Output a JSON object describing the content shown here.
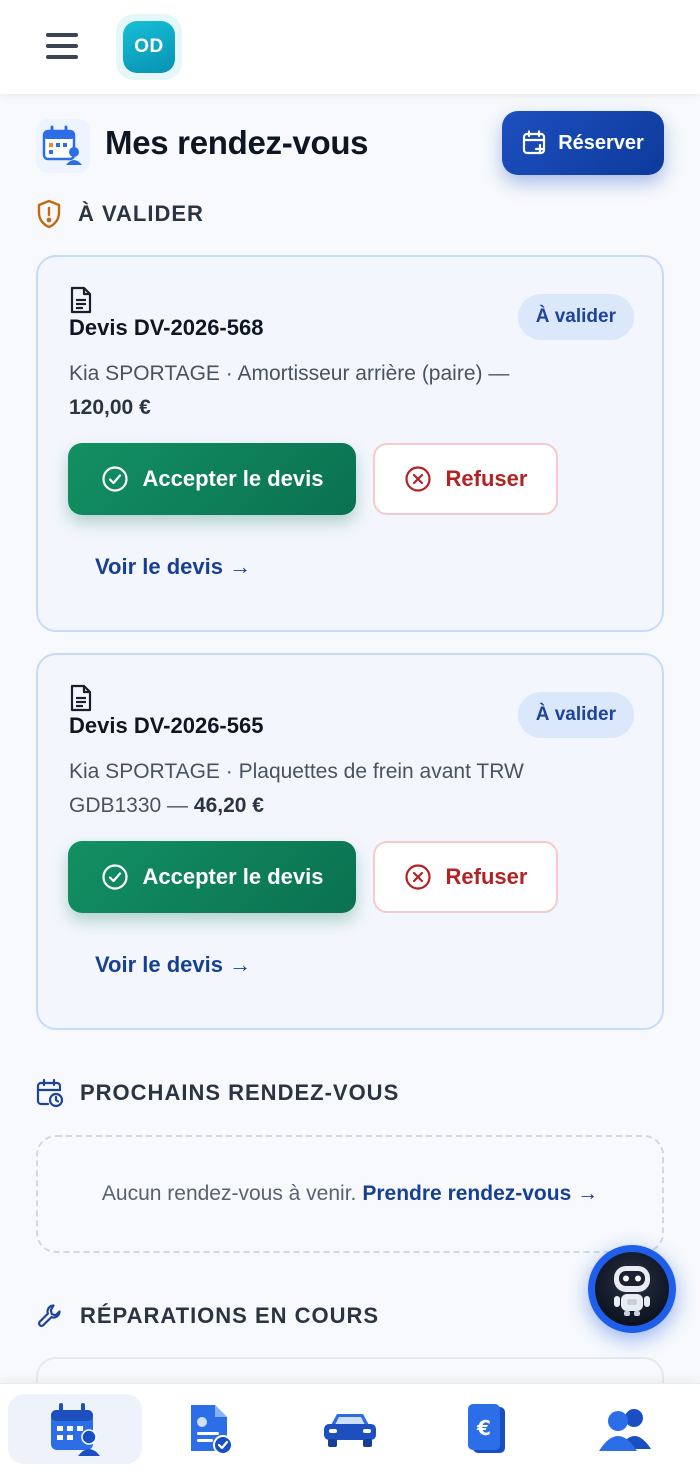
{
  "header": {
    "avatar_initials": "OD"
  },
  "page": {
    "title": "Mes rendez-vous",
    "reserve_label": "Réserver"
  },
  "sections": {
    "to_validate": "À VALIDER",
    "upcoming": "PROCHAINS RENDEZ-VOUS",
    "repairs": "RÉPARATIONS EN COURS"
  },
  "quotes": [
    {
      "title": "Devis DV-2026-568",
      "badge": "À valider",
      "description": "Kia SPORTAGE · Amortisseur arrière (paire) —",
      "amount": "120,00 €",
      "accept_label": "Accepter le devis",
      "refuse_label": "Refuser",
      "see_label": "Voir le devis →"
    },
    {
      "title": "Devis DV-2026-565",
      "badge": "À valider",
      "description": "Kia SPORTAGE · Plaquettes de frein avant TRW GDB1330 —",
      "amount": "46,20 €",
      "accept_label": "Accepter le devis",
      "refuse_label": "Refuser",
      "see_label": "Voir le devis →"
    }
  ],
  "upcoming": {
    "empty_text": "Aucun rendez-vous à venir.",
    "link_label": "Prendre rendez-vous →"
  },
  "bottom_nav": [
    {
      "icon": "calendar-icon",
      "active": true
    },
    {
      "icon": "document-check-icon",
      "active": false
    },
    {
      "icon": "car-icon",
      "active": false
    },
    {
      "icon": "euro-invoice-icon",
      "active": false
    },
    {
      "icon": "users-icon",
      "active": false
    }
  ],
  "colors": {
    "primary": "#1d4fbf",
    "success": "#0f8a5f",
    "danger": "#b42323",
    "badge_bg": "#dbe8fb",
    "shield_orange": "#c26a12"
  }
}
